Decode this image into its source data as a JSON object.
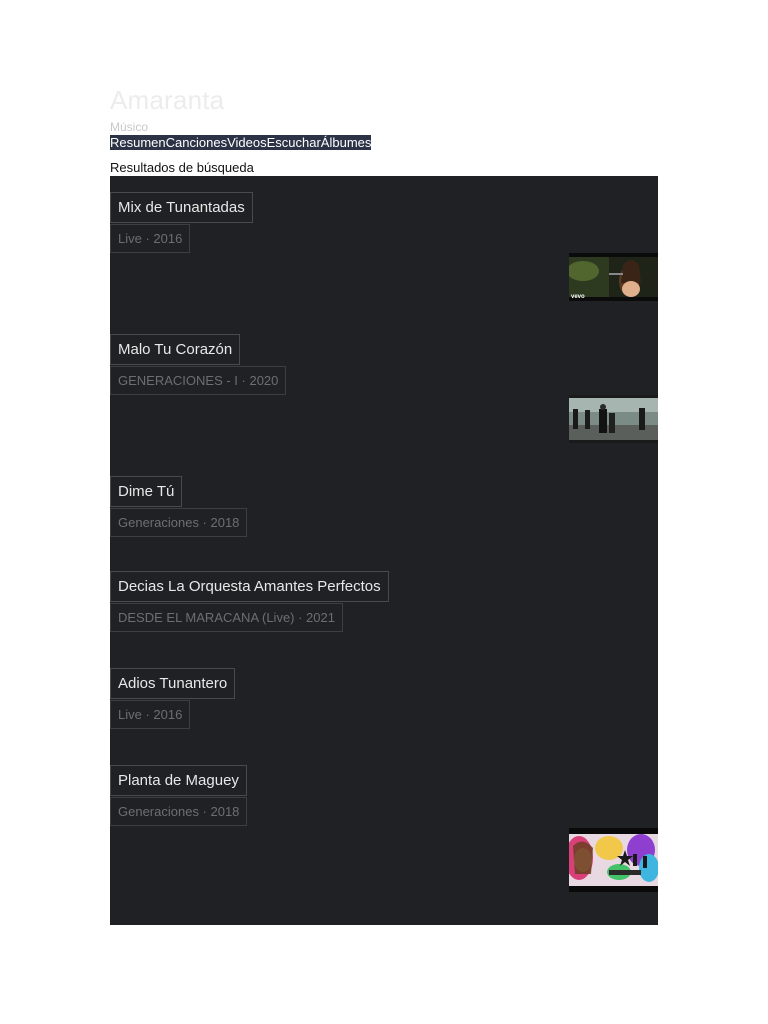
{
  "artist": {
    "name": "Amaranta",
    "type": "Músico"
  },
  "tabs": [
    "Resumen",
    "Canciones",
    "Videos",
    "Escuchar",
    "Álbumes"
  ],
  "results_heading": "Resultados de búsqueda",
  "results": [
    {
      "title": "Mix de Tunantadas",
      "meta": "Live · 2016",
      "has_thumbnail": true,
      "thumbnail_caption": "vevo"
    },
    {
      "title": "Malo Tu Corazón",
      "meta": "GENERACIONES - I · 2020",
      "has_thumbnail": true
    },
    {
      "title": "Dime Tú",
      "meta": "Generaciones · 2018",
      "has_thumbnail": false
    },
    {
      "title": "Decias La Orquesta Amantes Perfectos",
      "meta": "DESDE EL MARACANA (Live) · 2021",
      "has_thumbnail": false
    },
    {
      "title": "Adios Tunantero",
      "meta": "Live · 2016",
      "has_thumbnail": false
    },
    {
      "title": "Planta de Maguey",
      "meta": "Generaciones · 2018",
      "has_thumbnail": true
    }
  ],
  "colors": {
    "results_background": "#202124",
    "tab_bar_background": "#2d3347"
  }
}
